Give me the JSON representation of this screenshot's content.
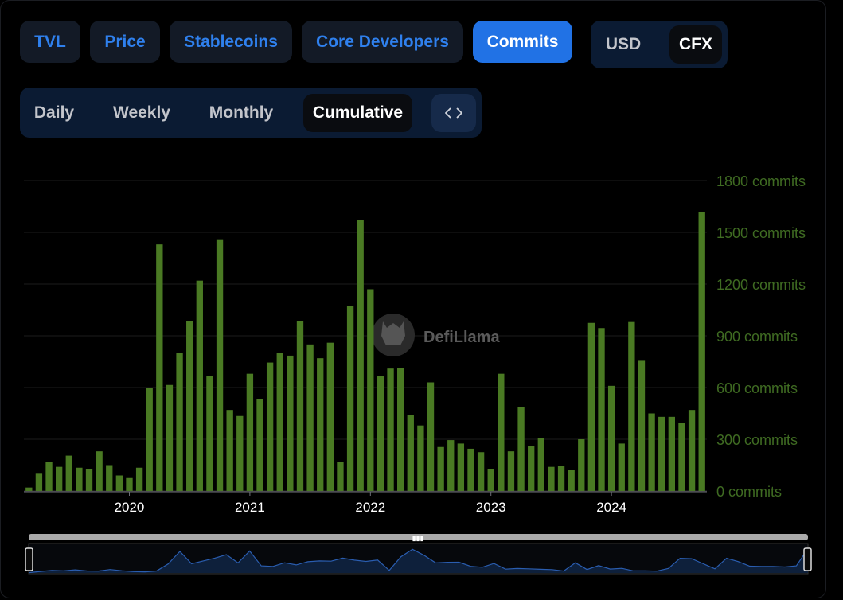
{
  "tabs": [
    {
      "label": "TVL",
      "active": false
    },
    {
      "label": "Price",
      "active": false
    },
    {
      "label": "Stablecoins",
      "active": false
    },
    {
      "label": "Core Developers",
      "active": false
    },
    {
      "label": "Commits",
      "active": true
    }
  ],
  "denomination": {
    "options": [
      "USD",
      "CFX"
    ],
    "selected": "CFX"
  },
  "periods": {
    "options": [
      "Daily",
      "Weekly",
      "Monthly",
      "Cumulative"
    ],
    "selected": "Cumulative"
  },
  "embed_icon": "code-brackets-icon",
  "watermark": "DefiLlama",
  "colors": {
    "bar": "#4a7a23",
    "axis_label": "#3f6b22",
    "accent": "#2172e5",
    "brush_line": "#1f4a8a"
  },
  "chart_data": {
    "type": "bar",
    "title": "",
    "xlabel": "",
    "ylabel": "",
    "x_tick_labels": [
      "2020",
      "2021",
      "2022",
      "2023",
      "2024"
    ],
    "y_tick_labels": [
      "0 commits",
      "300 commits",
      "600 commits",
      "900 commits",
      "1200 commits",
      "1500 commits",
      "1800 commits"
    ],
    "ylim": [
      0,
      1800
    ],
    "grid": true,
    "start_month": "2019-03",
    "series": [
      {
        "values": [
          20,
          100,
          170,
          140,
          205,
          135,
          125,
          230,
          150,
          90,
          75,
          135,
          600,
          1430,
          615,
          800,
          985,
          1220,
          665,
          1460,
          470,
          435,
          680,
          535,
          745,
          800,
          785,
          985,
          850,
          770,
          860,
          170,
          1075,
          1570,
          1170,
          665,
          710,
          715,
          440,
          380,
          630,
          255,
          295,
          275,
          245,
          225,
          125,
          680,
          230,
          485,
          260,
          305,
          140,
          145,
          120,
          300,
          975,
          945,
          610,
          275,
          980,
          755,
          450,
          430,
          430,
          395,
          470,
          1620
        ]
      }
    ]
  }
}
